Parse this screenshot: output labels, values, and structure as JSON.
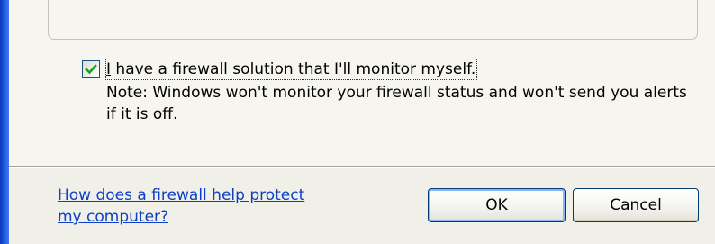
{
  "firewall_option": {
    "checked": true,
    "label_accel": "I",
    "label_rest": " have a firewall solution that I'll monitor myself.",
    "note": "Note: Windows won't monitor your firewall status and won't send you alerts if it is off."
  },
  "footer": {
    "help_link": "How does a firewall help protect my computer?",
    "ok_label": "OK",
    "cancel_label": "Cancel"
  },
  "colors": {
    "link": "#0b3fc6",
    "window_frame": "#1f5ae0",
    "check_mark": "#21a121"
  }
}
